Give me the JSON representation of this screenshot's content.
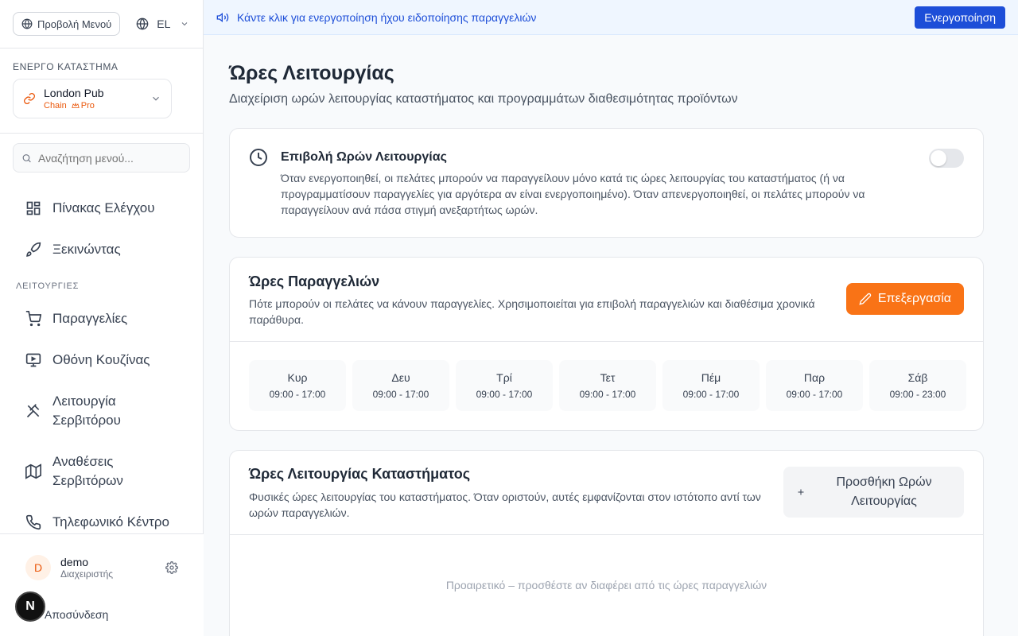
{
  "sidebar": {
    "menu_view_label": "Προβολή Μενού",
    "language": "EL",
    "store_section_label": "ΕΝΕΡΓΟ ΚΑΤΑΣΤΗΜΑ",
    "store": {
      "name": "London Pub",
      "type": "Chain",
      "plan": "Pro"
    },
    "search_placeholder": "Αναζήτηση μενού...",
    "nav_top": [
      {
        "label": "Πίνακας Ελέγχου",
        "icon": "dashboard-icon"
      },
      {
        "label": "Ξεκινώντας",
        "icon": "rocket-icon"
      }
    ],
    "functions_heading": "ΛΕΙΤΟΥΡΓΙΕΣ",
    "nav_functions": [
      {
        "label": "Παραγγελίες",
        "icon": "cart-icon"
      },
      {
        "label": "Οθόνη Κουζίνας",
        "icon": "monitor-icon"
      },
      {
        "label_line1": "Λειτουργία",
        "label_line2": "Σερβιτόρου",
        "icon": "utensils-icon"
      },
      {
        "label_line1": "Αναθέσεις",
        "label_line2": "Σερβιτόρων",
        "icon": "map-icon"
      },
      {
        "label": "Τηλεφωνικό Κέντρο",
        "icon": "phone-icon"
      }
    ],
    "user": {
      "initial": "D",
      "name": "demo",
      "role": "Διαχειριστής"
    },
    "logout_label": "Αποσύνδεση"
  },
  "banner": {
    "text": "Κάντε κλικ για ενεργοποίηση ήχου ειδοποίησης παραγγελιών",
    "button": "Ενεργοποίηση"
  },
  "page": {
    "title": "Ώρες Λειτουργίας",
    "subtitle": "Διαχείριση ωρών λειτουργίας καταστήματος και προγραμμάτων διαθεσιμότητας προϊόντων"
  },
  "enforce_card": {
    "title": "Επιβολή Ωρών Λειτουργίας",
    "description": "Όταν ενεργοποιηθεί, οι πελάτες μπορούν να παραγγείλουν μόνο κατά τις ώρες λειτουργίας του καταστήματος (ή να προγραμματίσουν παραγγελίες για αργότερα αν είναι ενεργοποιημένο). Όταν απενεργοποιηθεί, οι πελάτες μπορούν να παραγγείλουν ανά πάσα στιγμή ανεξαρτήτως ωρών.",
    "enabled": false
  },
  "order_hours_card": {
    "title": "Ώρες Παραγγελιών",
    "description": "Πότε μπορούν οι πελάτες να κάνουν παραγγελίες. Χρησιμοποιείται για επιβολή παραγγελιών και διαθέσιμα χρονικά παράθυρα.",
    "edit_button": "Επεξεργασία",
    "days": [
      {
        "day": "Κυρ",
        "hours": "09:00 - 17:00"
      },
      {
        "day": "Δευ",
        "hours": "09:00 - 17:00"
      },
      {
        "day": "Τρί",
        "hours": "09:00 - 17:00"
      },
      {
        "day": "Τετ",
        "hours": "09:00 - 17:00"
      },
      {
        "day": "Πέμ",
        "hours": "09:00 - 17:00"
      },
      {
        "day": "Παρ",
        "hours": "09:00 - 17:00"
      },
      {
        "day": "Σάβ",
        "hours": "09:00 - 23:00"
      }
    ]
  },
  "store_hours_card": {
    "title": "Ώρες Λειτουργίας Καταστήματος",
    "description": "Φυσικές ώρες λειτουργίας του καταστήματος. Όταν οριστούν, αυτές εμφανίζονται στον ιστότοπο αντί των ωρών παραγγελιών.",
    "add_button_line1": "Προσθήκη Ωρών",
    "add_button_line2": "Λειτουργίας",
    "empty_note": "Προαιρετικό – προσθέστε αν διαφέρει από τις ώρες παραγγελιών"
  },
  "colors": {
    "accent": "#f97316",
    "banner_blue": "#1d4ed8"
  }
}
